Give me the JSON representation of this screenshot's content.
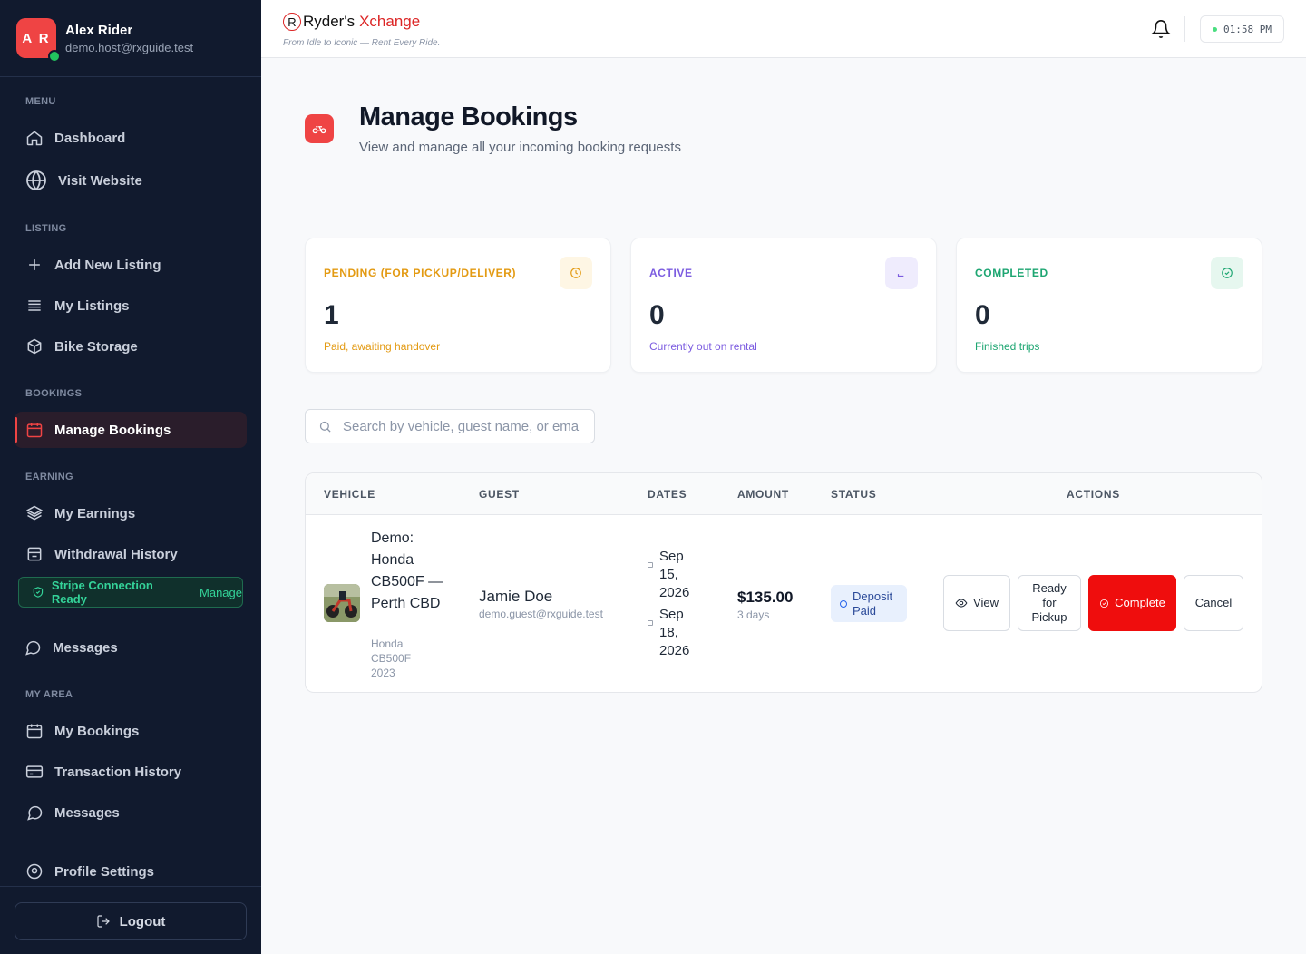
{
  "user": {
    "initials": "A R",
    "name": "Alex Rider",
    "email": "demo.host@rxguide.test"
  },
  "sidebar": {
    "sections": {
      "menu": "MENU",
      "listing": "LISTING",
      "bookings": "BOOKINGS",
      "earning": "EARNING",
      "my_area": "MY AREA"
    },
    "items": {
      "dashboard": "Dashboard",
      "visit_website": "Visit Website",
      "add_listing": "Add New Listing",
      "my_listings": "My Listings",
      "bike_storage": "Bike Storage",
      "manage_bookings": "Manage Bookings",
      "my_earnings": "My Earnings",
      "withdrawal_history": "Withdrawal History",
      "messages_host": "Messages",
      "my_bookings": "My Bookings",
      "transaction_history": "Transaction History",
      "messages_area": "Messages",
      "profile_settings": "Profile Settings"
    },
    "stripe": {
      "label": "Stripe Connection Ready",
      "action": "Manage"
    },
    "logout": "Logout"
  },
  "topbar": {
    "brand_a": "Ryder's",
    "brand_b": "Xchange",
    "logo_letter": "R",
    "tagline": "From Idle to Iconic — Rent Every Ride.",
    "time": "01:58 PM"
  },
  "page": {
    "title": "Manage Bookings",
    "subtitle": "View and manage all your incoming booking requests"
  },
  "stats": [
    {
      "label": "PENDING (FOR PICKUP/DELIVER)",
      "value": "1",
      "note": "Paid, awaiting handover",
      "color": "#e39a12",
      "icon_bg": "#fef6e4",
      "icon": "clock-icon"
    },
    {
      "label": "ACTIVE",
      "value": "0",
      "note": "Currently out on rental",
      "color": "#7c5ce0",
      "icon_bg": "#efecfd",
      "icon": "bike-icon"
    },
    {
      "label": "COMPLETED",
      "value": "0",
      "note": "Finished trips",
      "color": "#1ea672",
      "icon_bg": "#e6f7ef",
      "icon": "check-circle-icon"
    }
  ],
  "search": {
    "placeholder": "Search by vehicle, guest name, or email"
  },
  "table": {
    "headers": [
      "VEHICLE",
      "GUEST",
      "DATES",
      "AMOUNT",
      "STATUS",
      "ACTIONS"
    ],
    "rows": [
      {
        "vehicle": "Demo: Honda CB500F — Perth CBD",
        "vehicle_sub": "Honda CB500F 2023",
        "guest": "Jamie Doe",
        "guest_email": "demo.guest@rxguide.test",
        "start": "Sep 15, 2026",
        "end": "Sep 18, 2026",
        "amount": "$135.00",
        "duration": "3 days",
        "status": "Deposit Paid",
        "actions": {
          "view": "View",
          "ready": "Ready for Pickup",
          "complete": "Complete",
          "cancel": "Cancel"
        }
      }
    ]
  },
  "colors": {
    "accent": "#ef4444",
    "sidebar_bg": "#111a2e",
    "success": "#34d399"
  }
}
